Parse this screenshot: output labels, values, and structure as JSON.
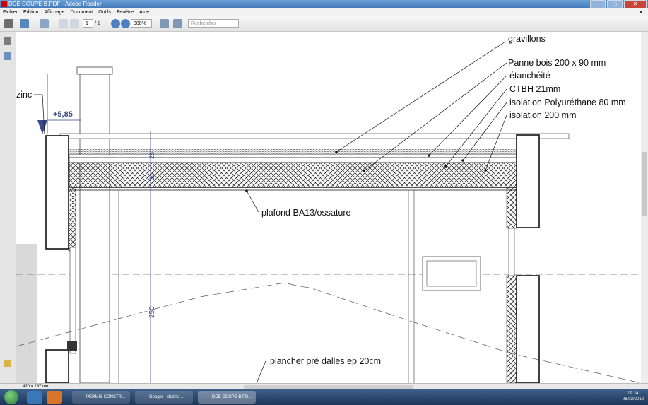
{
  "window": {
    "title": "DCE COUPE B.PDF - Adobe Reader"
  },
  "menu": {
    "items": [
      "Fichier",
      "Edition",
      "Affichage",
      "Document",
      "Outils",
      "Fenêtre",
      "Aide"
    ],
    "close": "x"
  },
  "toolbar": {
    "page_current": "1",
    "page_total": "/ 1",
    "zoom": "300%",
    "search_placeholder": "Rechercher"
  },
  "drawing": {
    "labels": {
      "gravillons": "gravillons",
      "panne": "Panne bois 200 x 90 mm",
      "etancheite": "étanchéité",
      "ctbh": "CTBH 21mm",
      "isolation_pu": "isolation Polyuréthane 80 mm",
      "isolation_200": "isolation 200 mm",
      "plafond": "plafond BA13/ossature",
      "plancher": "plancher pré dalles ep 20cm",
      "zinc": "zinc",
      "level": "+5,85",
      "dim_250": "250",
      "dim_25": "25",
      "dim_30": "30"
    }
  },
  "status": {
    "page_size": "420 x 297 mm"
  },
  "taskbar": {
    "items": [
      {
        "label": "PERMIS CONSTR..."
      },
      {
        "label": "Google - Mozilla ..."
      },
      {
        "label": "DCE COUPE B.PD..."
      }
    ],
    "time": "09:24",
    "date": "06/02/2012"
  }
}
